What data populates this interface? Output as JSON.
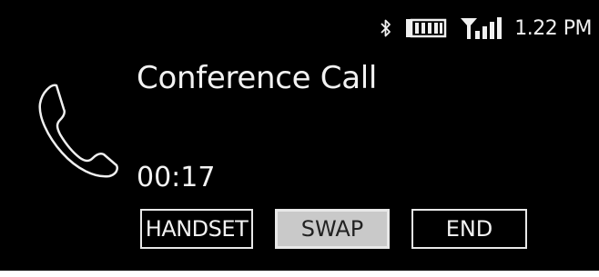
{
  "status_bar": {
    "time": "1.22 PM",
    "bluetooth_icon": "bluetooth-icon",
    "battery_icon": "battery-icon",
    "signal_icon": "signal-icon"
  },
  "call": {
    "title": "Conference Call",
    "duration": "00:17",
    "icon": "phone-handset-icon"
  },
  "actions": {
    "handset_label": "HANDSET",
    "swap_label": "SWAP",
    "end_label": "END"
  },
  "colors": {
    "background": "#000000",
    "foreground": "#f0f0f0",
    "selected_button": "#c9c9c9"
  }
}
